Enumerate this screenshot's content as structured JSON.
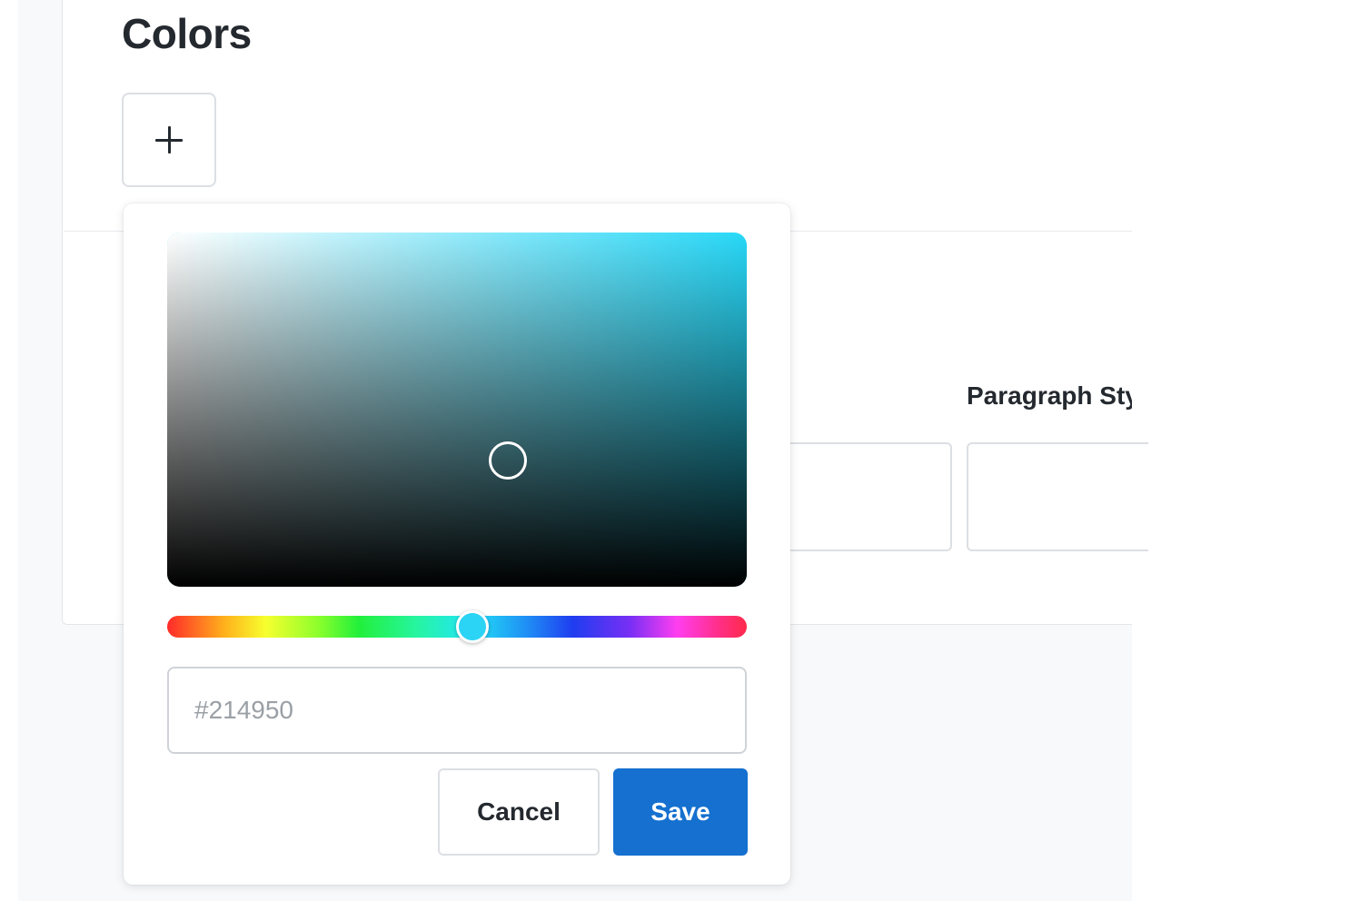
{
  "section": {
    "title": "Colors"
  },
  "add_color": {
    "icon": "plus-icon"
  },
  "paragraph_style": {
    "label": "Paragraph Sty"
  },
  "color_picker": {
    "hue_color": "#28d8f8",
    "hex_placeholder": "#214950",
    "hex_value": "",
    "cancel_label": "Cancel",
    "save_label": "Save",
    "save_color": "#1570cf"
  }
}
